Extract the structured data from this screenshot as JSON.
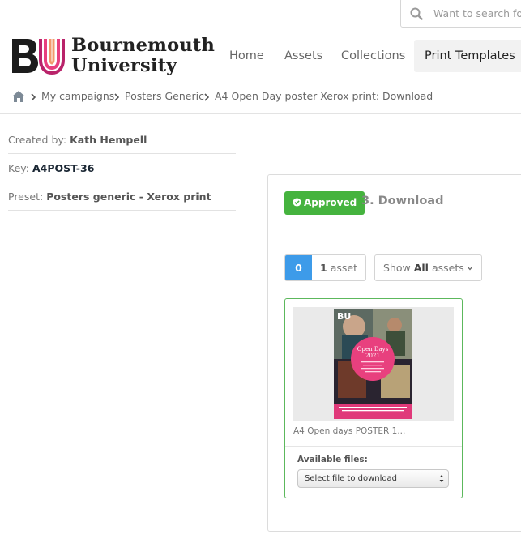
{
  "search": {
    "placeholder": "Want to search for"
  },
  "logo": {
    "line1": "Bournemouth",
    "line2": "University",
    "mark": "BU"
  },
  "nav": {
    "items": [
      {
        "label": "Home"
      },
      {
        "label": "Assets"
      },
      {
        "label": "Collections"
      },
      {
        "label": "Print Templates"
      }
    ]
  },
  "breadcrumb": {
    "items": [
      {
        "label": "My campaigns"
      },
      {
        "label": "Posters Generic"
      },
      {
        "label": "A4 Open Day poster Xerox print: Download"
      }
    ]
  },
  "meta": {
    "created_by_label": "Created by:",
    "created_by": "Kath Hempell",
    "key_label": "Key:",
    "key": "A4POST-36",
    "preset_label": "Preset:",
    "preset": "Posters generic - Xerox print"
  },
  "panel": {
    "status_badge": "Approved",
    "step_title": "3. Download",
    "selected_count": "0",
    "total_count": "1",
    "total_suffix": "asset",
    "show_prefix": "Show",
    "show_value": "All",
    "show_suffix": "assets"
  },
  "asset": {
    "name": "A4 Open days POSTER 1...",
    "available_label": "Available files:",
    "select_value": "Select file to download",
    "poster_title_1": "Open Days",
    "poster_title_2": "2021"
  },
  "colors": {
    "accent_blue": "#3d9be9",
    "approved_green": "#45b33e",
    "card_border": "#5cb85c",
    "brand_pink": "#e8407e"
  }
}
